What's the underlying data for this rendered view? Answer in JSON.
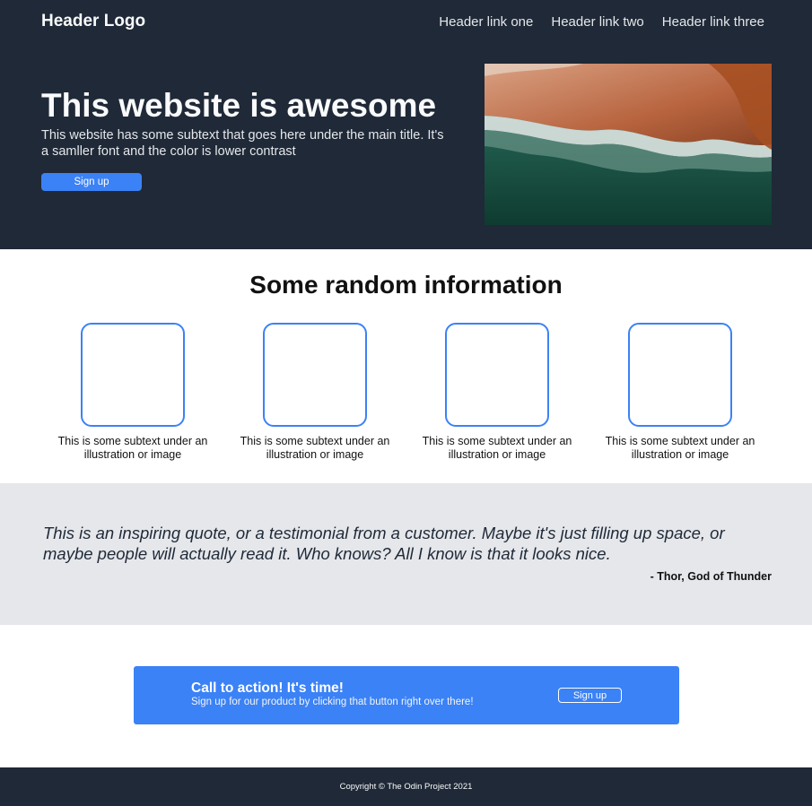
{
  "header": {
    "logo": "Header Logo",
    "links": [
      "Header link one",
      "Header link two",
      "Header link three"
    ]
  },
  "hero": {
    "title": "This website is awesome",
    "subtitle": "This website has some subtext that goes here under the main title. It's a samller font and the color is lower contrast",
    "button_label": "Sign up"
  },
  "info": {
    "title": "Some random information",
    "cards": [
      {
        "text": "This is some subtext under an illustration or image"
      },
      {
        "text": "This is some subtext under an illustration or image"
      },
      {
        "text": "This is some subtext under an illustration or image"
      },
      {
        "text": "This is some subtext under an illustration or image"
      }
    ]
  },
  "quote": {
    "text": "This is an inspiring quote, or a testimonial from a customer. Maybe it's just filling up space, or maybe people will actually read it. Who knows? All I know is that it looks nice.",
    "author": "- Thor, God of Thunder"
  },
  "cta": {
    "title": "Call to action! It's time!",
    "subtitle": "Sign up for our product by clicking that button right over there!",
    "button_label": "Sign up"
  },
  "footer": {
    "copyright": "Copyright © The Odin Project 2021"
  },
  "colors": {
    "dark": "#1f2937",
    "accent": "#3b82f6",
    "light_gray": "#e5e7eb"
  }
}
